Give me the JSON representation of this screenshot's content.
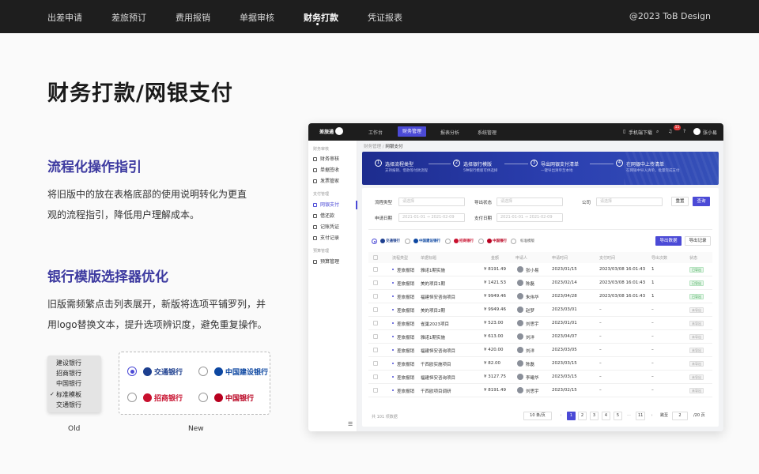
{
  "topnav": {
    "items": [
      "出差申请",
      "差旅预订",
      "费用报销",
      "单据审核",
      "财务打款",
      "凭证报表"
    ],
    "active_index": 4,
    "copyright": "@2023 ToB Design"
  },
  "page_title": "财务打款/网银支付",
  "section1": {
    "title": "流程化操作指引",
    "body": [
      "将旧版中的放在表格底部的使用说明转化为更直",
      "观的流程指引，降低用户理解成本。"
    ]
  },
  "section2": {
    "title": "银行模版选择器优化",
    "body": [
      "旧版需频繁点击列表展开，新版将选项平铺罗列，并",
      "用logo替换文本，提升选项辨识度，避免重复操作。"
    ]
  },
  "old_dropdown": {
    "options": [
      "建设银行",
      "招商银行",
      "中国银行",
      "标准模板",
      "交通银行"
    ],
    "checked_index": 3,
    "caption": "Old"
  },
  "new_selector": {
    "caption": "New",
    "banks": [
      {
        "name": "交通银行",
        "color": "#1d3f8f",
        "checked": true,
        "icon": "bocom-logo-icon"
      },
      {
        "name": "中国建设银行",
        "color": "#0d47a1",
        "checked": false,
        "icon": "ccb-logo-icon"
      },
      {
        "name": "招商银行",
        "color": "#c8102e",
        "checked": false,
        "icon": "cmb-logo-icon"
      },
      {
        "name": "中国银行",
        "color": "#b8001f",
        "checked": false,
        "icon": "boc-logo-icon"
      }
    ]
  },
  "app": {
    "logo": "差旅通",
    "nav": [
      "工作台",
      "财务管理",
      "报表分析",
      "系统管理"
    ],
    "nav_active_index": 1,
    "header_right": {
      "mobile": "手机端下载",
      "badge": "11",
      "user": "张小易"
    },
    "sidebar": {
      "groups": [
        {
          "title": "财务审核",
          "items": [
            "财务审核",
            "单据签收",
            "发票管家"
          ]
        },
        {
          "title": "支付管理",
          "items": [
            "网银支付",
            "借还款",
            "记账凭证",
            "支付记录"
          ]
        },
        {
          "title": "预算管理",
          "items": [
            "预算管理"
          ]
        }
      ],
      "active_item": "网银支付",
      "collapse_icon": "☰"
    },
    "breadcrumb": {
      "parent": "财务管理",
      "separator": "/",
      "current": "网银支付"
    },
    "steps": [
      {
        "num": "1",
        "title": "选择流程类型",
        "desc": "支持报销、借款等付款流程"
      },
      {
        "num": "2",
        "title": "选择银行模版",
        "desc": "5种银行模版可供选择"
      },
      {
        "num": "3",
        "title": "导出网银支付清单",
        "desc": "一键导出清单至本地"
      },
      {
        "num": "4",
        "title": "在网银中上传清单",
        "desc": "在网银中导入清单，批量完成支付"
      }
    ],
    "filters": {
      "flow_type": {
        "label": "流程类型",
        "placeholder": "请选择"
      },
      "export_status": {
        "label": "导出状态",
        "placeholder": "请选择"
      },
      "company": {
        "label": "公司",
        "placeholder": "请选择"
      },
      "apply_date": {
        "label": "申请日期",
        "start": "2021-01-01",
        "sep": "→",
        "end": "2021-02-09"
      },
      "pay_date": {
        "label": "支付日期",
        "start": "2021-01-01",
        "sep": "→",
        "end": "2021-02-09"
      },
      "reset": "重置",
      "search": "查询"
    },
    "bank_templates": [
      {
        "name": "交通银行",
        "color": "#1d3f8f",
        "checked": true
      },
      {
        "name": "中国建设银行",
        "color": "#0d47a1",
        "checked": false
      },
      {
        "name": "招商银行",
        "color": "#c8102e",
        "checked": false
      },
      {
        "name": "中国银行",
        "color": "#b8001f",
        "checked": false
      },
      {
        "name": "标准模版",
        "color": "",
        "checked": false
      }
    ],
    "export_btn": "导出数据",
    "record_btn": "导出记录",
    "table": {
      "headers": [
        "流程类型",
        "单据标题",
        "金额",
        "申请人",
        "申请时间",
        "支付时间",
        "导出次数",
        "状态"
      ],
      "rows": [
        {
          "type": "差旅报销",
          "title": "雅诺1期实施",
          "amount": "¥ 8191.49",
          "applicant": "张小易",
          "apply": "2023/01/15",
          "pay": "2023/03/08 16:01:43",
          "count": "1",
          "status": "已导出"
        },
        {
          "type": "差旅报销",
          "title": "美的项目1期",
          "amount": "¥ 1421.53",
          "applicant": "陈磊",
          "apply": "2023/02/14",
          "pay": "2023/03/08 16:01:43",
          "count": "1",
          "status": "已导出"
        },
        {
          "type": "差旅报销",
          "title": "福建恒安咨询项目",
          "amount": "¥ 9949.46",
          "applicant": "朱伟华",
          "apply": "2023/04/28",
          "pay": "2023/03/08 16:01:43",
          "count": "1",
          "status": "已导出"
        },
        {
          "type": "差旅报销",
          "title": "美的项目2期",
          "amount": "¥ 9949.46",
          "applicant": "赵梦",
          "apply": "2023/03/01",
          "pay": "–",
          "count": "–",
          "status": "未导出"
        },
        {
          "type": "差旅报销",
          "title": "雀巢2023项目",
          "amount": "¥ 523.00",
          "applicant": "刘思宇",
          "apply": "2023/01/01",
          "pay": "–",
          "count": "–",
          "status": "未导出"
        },
        {
          "type": "差旅报销",
          "title": "雅诺1期实施",
          "amount": "¥ 613.00",
          "applicant": "刘洋",
          "apply": "2023/04/07",
          "pay": "–",
          "count": "–",
          "status": "未导出"
        },
        {
          "type": "差旅报销",
          "title": "福建恒安咨询项目",
          "amount": "¥ 420.00",
          "applicant": "刘洋",
          "apply": "2023/03/05",
          "pay": "–",
          "count": "–",
          "status": "未导出"
        },
        {
          "type": "差旅报销",
          "title": "千西欧实施项目",
          "amount": "¥ 82.00",
          "applicant": "陈磊",
          "apply": "2023/03/15",
          "pay": "–",
          "count": "–",
          "status": "未导出"
        },
        {
          "type": "差旅报销",
          "title": "福建恒安咨询项目",
          "amount": "¥ 3127.75",
          "applicant": "李曦华",
          "apply": "2023/03/15",
          "pay": "–",
          "count": "–",
          "status": "未导出"
        },
        {
          "type": "差旅报销",
          "title": "千西欧项目调研",
          "amount": "¥ 8191.49",
          "applicant": "刘思宇",
          "apply": "2023/02/15",
          "pay": "–",
          "count": "–",
          "status": "未导出"
        }
      ]
    },
    "pagination": {
      "total": "共 101 项数据",
      "page_size": "10 条/页",
      "prev": "‹",
      "pages": [
        "1",
        "2",
        "3",
        "4",
        "5"
      ],
      "ellipsis": "···",
      "last": "11",
      "next": "›",
      "jump_label": "跳至",
      "jump_value": "2",
      "jump_suffix": "/20 页",
      "active": "1"
    }
  }
}
